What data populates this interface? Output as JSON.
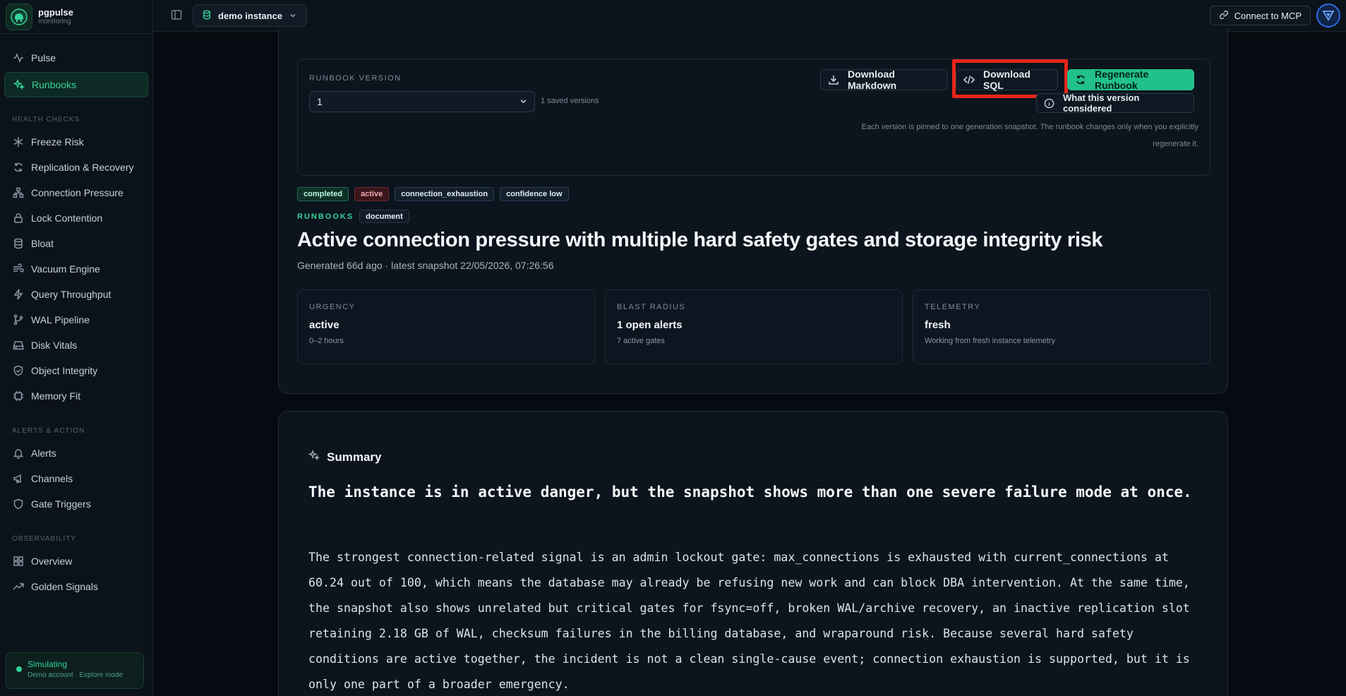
{
  "brand": {
    "name": "pgpulse",
    "subtitle": "monitoring"
  },
  "nav": {
    "top": [
      {
        "label": "Pulse",
        "icon": "activity-icon",
        "active": false
      },
      {
        "label": "Runbooks",
        "icon": "sparkles-icon",
        "active": true
      }
    ],
    "health_title": "HEALTH CHECKS",
    "health": [
      {
        "label": "Freeze Risk",
        "icon": "snowflake-icon"
      },
      {
        "label": "Replication & Recovery",
        "icon": "refresh-icon"
      },
      {
        "label": "Connection Pressure",
        "icon": "network-icon"
      },
      {
        "label": "Lock Contention",
        "icon": "lock-icon"
      },
      {
        "label": "Bloat",
        "icon": "database-icon"
      },
      {
        "label": "Vacuum Engine",
        "icon": "wind-icon"
      },
      {
        "label": "Query Throughput",
        "icon": "zap-icon"
      },
      {
        "label": "WAL Pipeline",
        "icon": "git-branch-icon"
      },
      {
        "label": "Disk Vitals",
        "icon": "hard-drive-icon"
      },
      {
        "label": "Object Integrity",
        "icon": "shield-check-icon"
      },
      {
        "label": "Memory Fit",
        "icon": "cpu-icon"
      }
    ],
    "alerts_title": "ALERTS & ACTION",
    "alerts": [
      {
        "label": "Alerts",
        "icon": "bell-icon"
      },
      {
        "label": "Channels",
        "icon": "megaphone-icon"
      },
      {
        "label": "Gate Triggers",
        "icon": "shield-icon"
      }
    ],
    "obs_title": "OBSERVABILITY",
    "obs": [
      {
        "label": "Overview",
        "icon": "grid-icon"
      },
      {
        "label": "Golden Signals",
        "icon": "trending-up-icon"
      }
    ]
  },
  "simulating": {
    "title": "Simulating",
    "subtitle": "Demo account · Explore mode"
  },
  "topbar": {
    "instance": "demo instance",
    "mcp": "Connect to MCP"
  },
  "version": {
    "label": "RUNBOOK VERSION",
    "selected": "1",
    "saved": "1 saved versions",
    "download_md": "Download Markdown",
    "download_sql": "Download SQL",
    "regenerate": "Regenerate Runbook",
    "considered": "What this version considered",
    "note_line1": "Each version is pinned to one generation snapshot. The runbook changes only when you explicitly",
    "note_line2": "regenerate it."
  },
  "tags": [
    {
      "label": "completed",
      "style": "green"
    },
    {
      "label": "active",
      "style": "red"
    },
    {
      "label": "connection_exhaustion",
      "style": "blue"
    },
    {
      "label": "confidence low",
      "style": "blue"
    }
  ],
  "crumb": {
    "section": "RUNBOOKS",
    "type": "document"
  },
  "title": "Active connection pressure with multiple hard safety gates and storage integrity risk",
  "generated": "Generated 66d ago · latest snapshot 22/05/2026, 07:26:56",
  "stats": [
    {
      "label": "URGENCY",
      "value": "active",
      "sub": "0–2 hours"
    },
    {
      "label": "BLAST RADIUS",
      "value": "1 open alerts",
      "sub": "7 active gates"
    },
    {
      "label": "TELEMETRY",
      "value": "fresh",
      "sub": "Working from fresh instance telemetry"
    }
  ],
  "summary": {
    "heading": "Summary",
    "lead": "The instance is in active danger, but the snapshot shows more than one severe failure mode at once.",
    "body": "The strongest connection-related signal is an admin lockout gate: max_connections is exhausted with current_connections at 60.24 out of 100, which means the database may already be refusing new work and can block DBA intervention. At the same time, the snapshot also shows unrelated but critical gates for fsync=off, broken WAL/archive recovery, an inactive replication slot retaining 2.18 GB of WAL, checksum failures in the billing database, and wraparound risk. Because several hard safety conditions are active together, the incident is not a clean single-cause event; connection exhaustion is supported, but it is only one part of a broader emergency."
  },
  "colors": {
    "accent": "#34d399",
    "regen": "#22c08a",
    "highlight": "#e8251b"
  }
}
